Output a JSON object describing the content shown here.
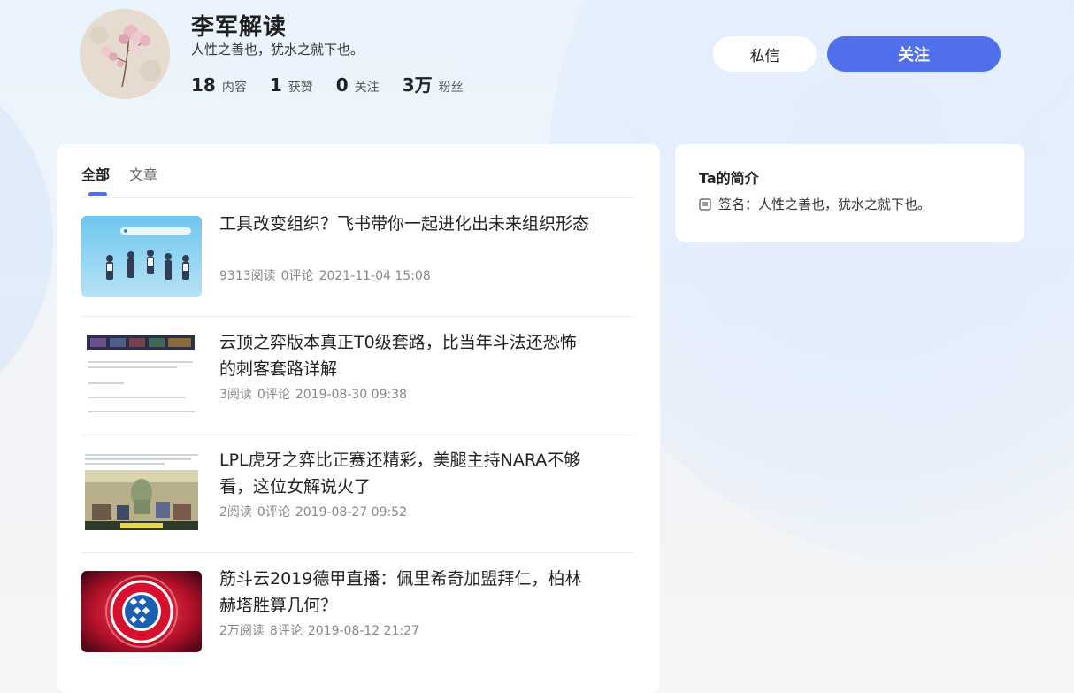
{
  "profile": {
    "name": "李军解读",
    "motto": "人性之善也，犹水之就下也。",
    "stats": [
      {
        "num": "18",
        "label": "内容"
      },
      {
        "num": "1",
        "label": "获赞"
      },
      {
        "num": "0",
        "label": "关注"
      },
      {
        "num": "3万",
        "label": "粉丝"
      }
    ],
    "message_button": "私信",
    "follow_button": "关注"
  },
  "tabs": [
    {
      "label": "全部",
      "active": true
    },
    {
      "label": "文章",
      "active": false
    }
  ],
  "articles": [
    {
      "title": "工具改变组织？飞书带你一起进化出未来组织形态",
      "reads": "9313阅读",
      "comments": "0评论",
      "date": "2021-11-04 15:08",
      "thumb": "people-jumping-image"
    },
    {
      "title": "云顶之弈版本真正T0级套路，比当年斗法还恐怖的刺客套路详解",
      "reads": "3阅读",
      "comments": "0评论",
      "date": "2019-08-30 09:38",
      "thumb": "game-screenshot-text-image"
    },
    {
      "title": "LPL虎牙之弈比正赛还精彩，美腿主持NARA不够看，这位女解说火了",
      "reads": "2阅读",
      "comments": "0评论",
      "date": "2019-08-27 09:52",
      "thumb": "studio-broadcast-image"
    },
    {
      "title": "筋斗云2019德甲直播：佩里希奇加盟拜仁，柏林赫塔胜算几何？",
      "reads": "2万阅读",
      "comments": "8评论",
      "date": "2019-08-12 21:27",
      "thumb": "fc-bayern-logo-image"
    }
  ],
  "sidebar": {
    "title": "Ta的简介",
    "sign": "签名：人性之善也，犹水之就下也。",
    "sign_icon": "document-icon"
  },
  "colors": {
    "accent": "#4f70ea",
    "text": "#222222",
    "muted": "#888888"
  }
}
